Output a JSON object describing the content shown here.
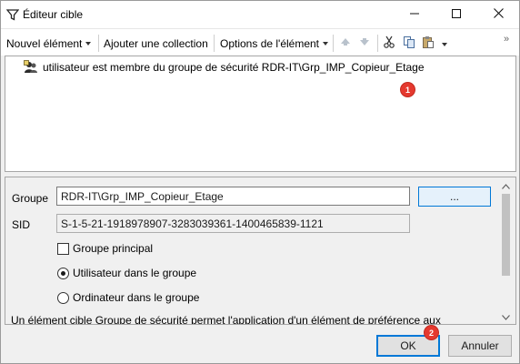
{
  "window": {
    "title": "Éditeur cible",
    "title_icon": "funnel-icon",
    "controls": [
      "minimize-icon",
      "maximize-icon",
      "close-icon"
    ]
  },
  "toolbar": {
    "new_item": "Nouvel élément",
    "add_collection": "Ajouter une collection",
    "item_options": "Options de l'élément",
    "icons": [
      "arrow-up-icon",
      "arrow-down-icon",
      "cut-icon",
      "copy-icon",
      "paste-icon"
    ],
    "overflow": "»"
  },
  "targets": [
    {
      "icon": "security-group-icon",
      "text": "utilisateur est membre du groupe de sécurité RDR-IT\\Grp_IMP_Copieur_Etage"
    }
  ],
  "badges": {
    "one": "1",
    "two": "2"
  },
  "form": {
    "group_label": "Groupe",
    "group_value": "RDR-IT\\Grp_IMP_Copieur_Etage",
    "browse_label": "...",
    "sid_label": "SID",
    "sid_value": "S-1-5-21-1918978907-3283039361-1400465839-1121",
    "primary_group_label": "Groupe principal",
    "primary_group_checked": false,
    "user_in_group_label": "Utilisateur dans le groupe",
    "computer_in_group_label": "Ordinateur dans le groupe",
    "selected_option": "user_in_group",
    "description": "Un élément cible Groupe de sécurité permet l'application d'un élément de préférence aux"
  },
  "buttons": {
    "ok": "OK",
    "cancel": "Annuler"
  },
  "colors": {
    "accent": "#0078d7",
    "badge": "#e5392f"
  }
}
